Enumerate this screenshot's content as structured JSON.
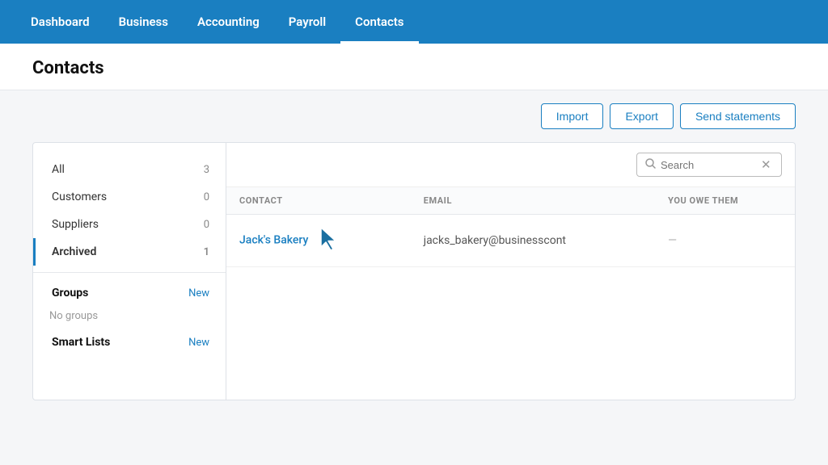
{
  "nav": {
    "items": [
      {
        "id": "dashboard",
        "label": "Dashboard",
        "active": false
      },
      {
        "id": "business",
        "label": "Business",
        "active": false
      },
      {
        "id": "accounting",
        "label": "Accounting",
        "active": false
      },
      {
        "id": "payroll",
        "label": "Payroll",
        "active": false
      },
      {
        "id": "contacts",
        "label": "Contacts",
        "active": true
      }
    ]
  },
  "page": {
    "title": "Contacts"
  },
  "actions": {
    "import_label": "Import",
    "export_label": "Export",
    "send_statements_label": "Send statements"
  },
  "sidebar": {
    "items": [
      {
        "id": "all",
        "label": "All",
        "count": "3",
        "new_link": null,
        "active": false
      },
      {
        "id": "customers",
        "label": "Customers",
        "count": "0",
        "new_link": null,
        "active": false
      },
      {
        "id": "suppliers",
        "label": "Suppliers",
        "count": "0",
        "new_link": null,
        "active": false
      },
      {
        "id": "archived",
        "label": "Archived",
        "count": "1",
        "new_link": null,
        "active": true
      }
    ],
    "groups_title": "Groups",
    "groups_new": "New",
    "no_groups_text": "No groups",
    "smart_lists_title": "Smart Lists",
    "smart_lists_new": "New"
  },
  "search": {
    "placeholder": "Search",
    "value": ""
  },
  "table": {
    "columns": [
      {
        "id": "contact",
        "label": "CONTACT"
      },
      {
        "id": "email",
        "label": "EMAIL"
      },
      {
        "id": "you_owe_them",
        "label": "YOU OWE THEM"
      }
    ],
    "rows": [
      {
        "contact": "Jack's Bakery",
        "email": "jacks_bakery@businesscont",
        "you_owe_them": "—"
      }
    ]
  }
}
